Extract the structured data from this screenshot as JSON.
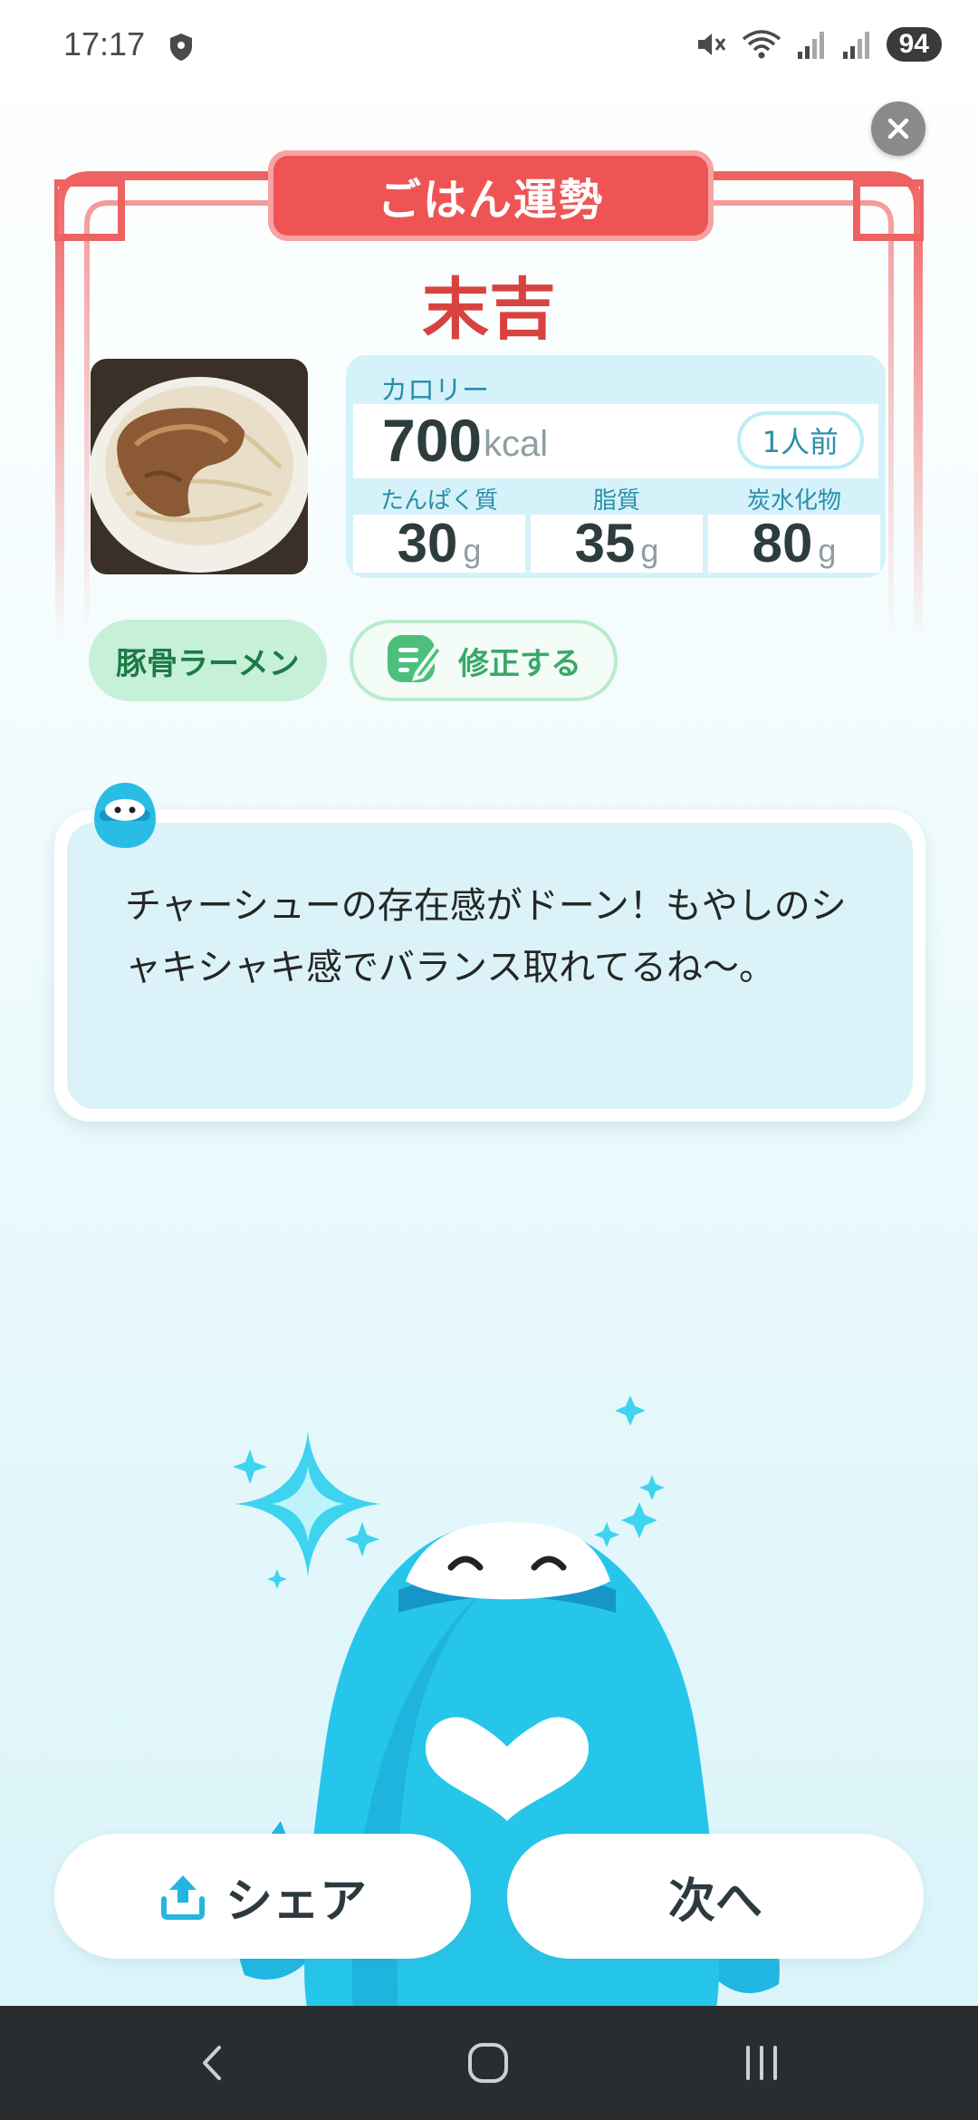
{
  "status_bar": {
    "time": "17:17",
    "battery": "94"
  },
  "fortune": {
    "banner_title": "ごはん運勢",
    "result": "末吉"
  },
  "nutrition": {
    "calorie_label": "カロリー",
    "calorie_value": "700",
    "calorie_unit": "kcal",
    "serving": "1人前",
    "macros": [
      {
        "label": "たんぱく質",
        "value": "30",
        "unit": "g"
      },
      {
        "label": "脂質",
        "value": "35",
        "unit": "g"
      },
      {
        "label": "炭水化物",
        "value": "80",
        "unit": "g"
      }
    ]
  },
  "dish": {
    "name": "豚骨ラーメン",
    "edit_label": "修正する"
  },
  "comment": {
    "text": "チャーシューの存在感がドーン！もやしのシャキシャキ感でバランス取れてるね〜。"
  },
  "actions": {
    "share_label": "シェア",
    "next_label": "次へ"
  },
  "colors": {
    "accent_red": "#ef5454",
    "accent_blue": "#2a8fa9",
    "accent_green": "#3aa86a",
    "mascot": "#26c6ea"
  },
  "icons": [
    "shield-icon",
    "mute-icon",
    "wifi-icon",
    "signal-icon",
    "close-icon",
    "edit-note-icon",
    "share-icon",
    "back-icon",
    "home-icon",
    "recents-icon"
  ]
}
